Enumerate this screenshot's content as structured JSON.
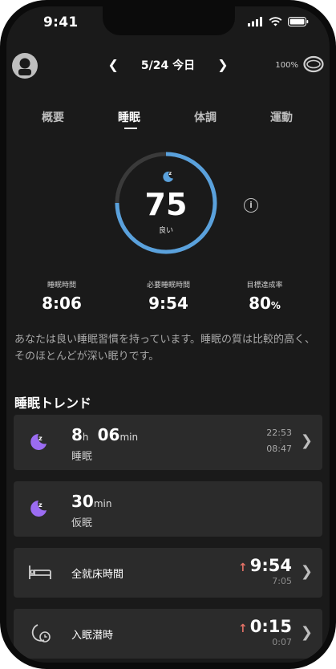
{
  "status_bar": {
    "time": "9:41"
  },
  "header": {
    "date": "5/24 今日",
    "prev_icon": "chevron-left-icon",
    "next_icon": "chevron-right-icon",
    "battery_percent": "100%",
    "device_icon": "ring-icon"
  },
  "tabs": [
    {
      "label": "概要",
      "active": false
    },
    {
      "label": "睡眠",
      "active": true
    },
    {
      "label": "体調",
      "active": false
    },
    {
      "label": "運動",
      "active": false
    }
  ],
  "score": {
    "value": "75",
    "label": "良い",
    "fraction": 0.75,
    "track_color": "#3a3a3a",
    "progress_color": "#5aa1dc"
  },
  "metrics": [
    {
      "label": "睡眠時間",
      "value": "8:06",
      "unit": ""
    },
    {
      "label": "必要睡眠時間",
      "value": "9:54",
      "unit": ""
    },
    {
      "label": "目標達成率",
      "value": "80",
      "unit": "%"
    }
  ],
  "description": "あなたは良い睡眠習慣を持っています。睡眠の質は比較的高く、そのほとんどが深い眠りです。",
  "trend": {
    "title": "睡眠トレンド",
    "cards": {
      "sleep": {
        "hours": "8",
        "hours_unit": "h",
        "minutes": "06",
        "minutes_unit": "min",
        "label": "睡眠",
        "start": "22:53",
        "end": "08:47"
      },
      "nap": {
        "minutes": "30",
        "minutes_unit": "min",
        "label": "仮眠"
      },
      "in_bed": {
        "label": "全就床時間",
        "value": "9:54",
        "prev": "7:05",
        "trend": "↑"
      },
      "latency": {
        "label": "入眠潜時",
        "value": "0:15",
        "prev": "0:07",
        "trend": "↑"
      }
    }
  },
  "colors": {
    "accent_purple": "#9b6cf2",
    "accent_blue": "#5aa1dc",
    "trend_up": "#e27166"
  }
}
